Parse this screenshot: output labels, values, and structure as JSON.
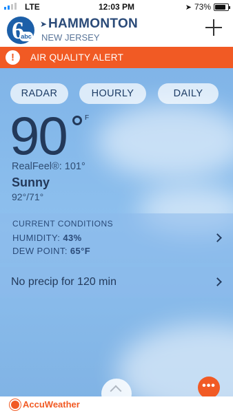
{
  "status_bar": {
    "network": "LTE",
    "time": "12:03 PM",
    "battery": "73%",
    "signal_bars": 2
  },
  "header": {
    "city": "HAMMONTON",
    "state": "NEW JERSEY",
    "logo_text": "abc",
    "logo_number": "6",
    "location_icon": "location-arrow-icon",
    "add_icon": "plus-icon"
  },
  "alert": {
    "text": "AIR QUALITY ALERT",
    "icon": "!",
    "color": "#f15a24"
  },
  "tabs": [
    {
      "label": "RADAR"
    },
    {
      "label": "HOURLY"
    },
    {
      "label": "DAILY"
    }
  ],
  "current": {
    "temperature": "90",
    "unit": "F",
    "realfeel": "RealFeel®: 101°",
    "condition": "Sunny",
    "hilo": "92°/71°"
  },
  "conditions": {
    "title": "CURRENT CONDITIONS",
    "humidity_label": "HUMIDITY:",
    "humidity_value": "43%",
    "dewpoint_label": "DEW POINT:",
    "dewpoint_value": "65°F"
  },
  "precip": {
    "text": "No precip for 120 min"
  },
  "more_button": {
    "label": "•••"
  },
  "footer": {
    "brand": "AccuWeather",
    "brand_color": "#f15a24"
  }
}
